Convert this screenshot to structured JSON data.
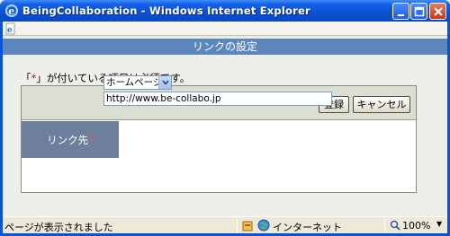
{
  "window": {
    "title": "BeingCollaboration - Windows Internet Explorer"
  },
  "page": {
    "title": "リンクの設定",
    "notice_open": "「",
    "notice_mark": "*",
    "notice_rest": "」が付いている項目は必須です。"
  },
  "toolbar": {
    "register_label": "登録",
    "cancel_label": "キャンセル"
  },
  "form": {
    "link_label": "リンク先",
    "required_mark": "*",
    "link_type": {
      "selected": "ホームページ"
    },
    "url_value": "http://www.be-collabo.jp"
  },
  "status": {
    "message": "ページが表示されました",
    "zone": "インターネット",
    "zoom": "100%"
  },
  "colors": {
    "header_band": "#5b87be",
    "label_cell": "#6e7f9d",
    "button_row": "#dadfd2",
    "required": "#dd0000"
  }
}
